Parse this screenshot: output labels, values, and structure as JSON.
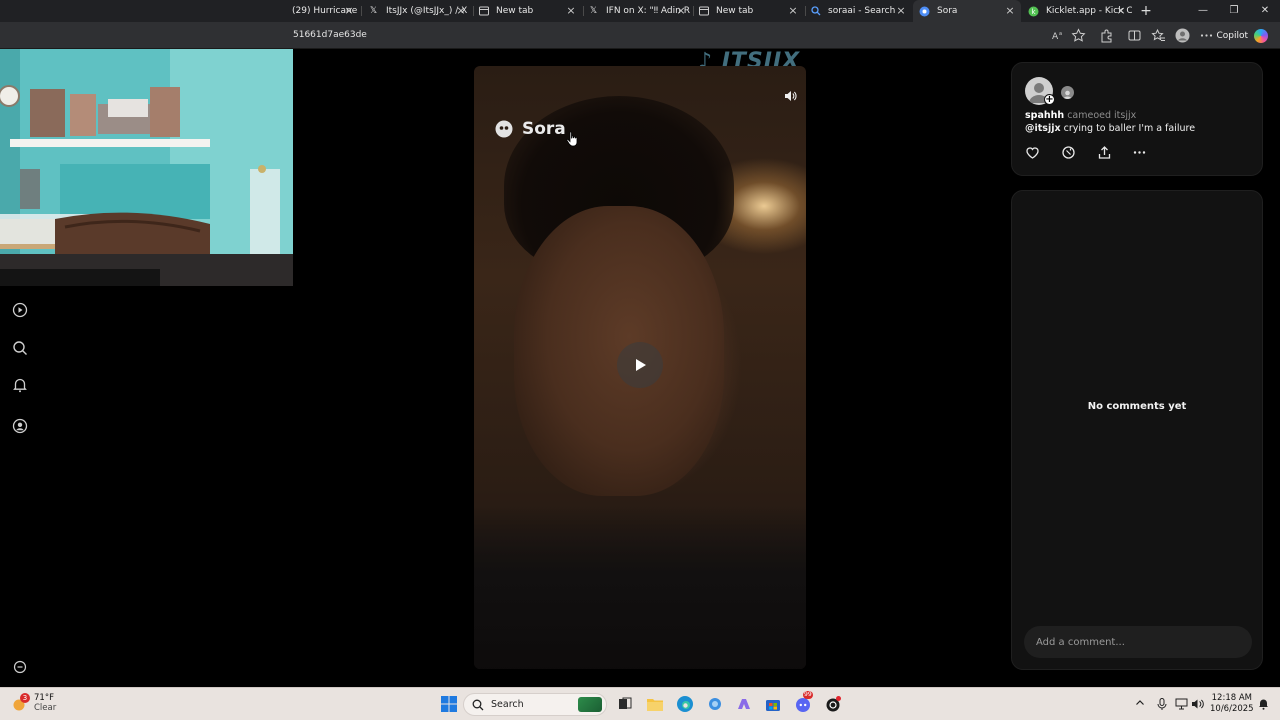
{
  "browser": {
    "tabs": [
      {
        "title": "(29) Hurricane",
        "icon": "page-icon",
        "active": false
      },
      {
        "title": "ItsJJx (@ItsJJx_) / X",
        "icon": "x-logo-icon",
        "active": false
      },
      {
        "title": "New tab",
        "icon": "newtab-icon",
        "active": false
      },
      {
        "title": "IFN on X: \"‼ Adin R",
        "icon": "x-logo-icon",
        "active": false
      },
      {
        "title": "New tab",
        "icon": "newtab-icon",
        "active": false
      },
      {
        "title": "soraai - Search",
        "icon": "search-icon",
        "active": false
      },
      {
        "title": "Sora",
        "icon": "sora-icon",
        "active": true
      },
      {
        "title": "Kicklet.app - Kick C",
        "icon": "kicklet-icon",
        "active": false
      }
    ],
    "new_tab_symbol": "+",
    "close_symbol": "×",
    "window_controls": {
      "minimize": "—",
      "restore": "❐",
      "close": "✕"
    },
    "address": {
      "url_fragment": "51661d7ae63de"
    },
    "copilot_label": "Copilot"
  },
  "video": {
    "logo_text": "Sora",
    "watermark_text": "ITSJJX",
    "play_icon": "play-icon",
    "mute_icon": "speaker-icon"
  },
  "post": {
    "author": "spahhh",
    "cameo_text": "cameoed itsjjx",
    "mention": "@itsjjx",
    "caption": " crying to baller I'm a failure",
    "actions": [
      "heart-icon",
      "remix-icon",
      "share-icon",
      "more-icon"
    ]
  },
  "comments": {
    "empty_text": "No comments yet",
    "input_placeholder": "Add a comment..."
  },
  "left_nav": [
    "play-icon",
    "search-icon",
    "bell-icon",
    "profile-icon",
    "more-icon"
  ],
  "taskbar": {
    "weather_temp": "71°F",
    "weather_condition": "Clear",
    "weather_badge": "3",
    "search_label": "Search",
    "time": "12:18 AM",
    "date": "10/6/2025",
    "discord_badge": "99"
  }
}
